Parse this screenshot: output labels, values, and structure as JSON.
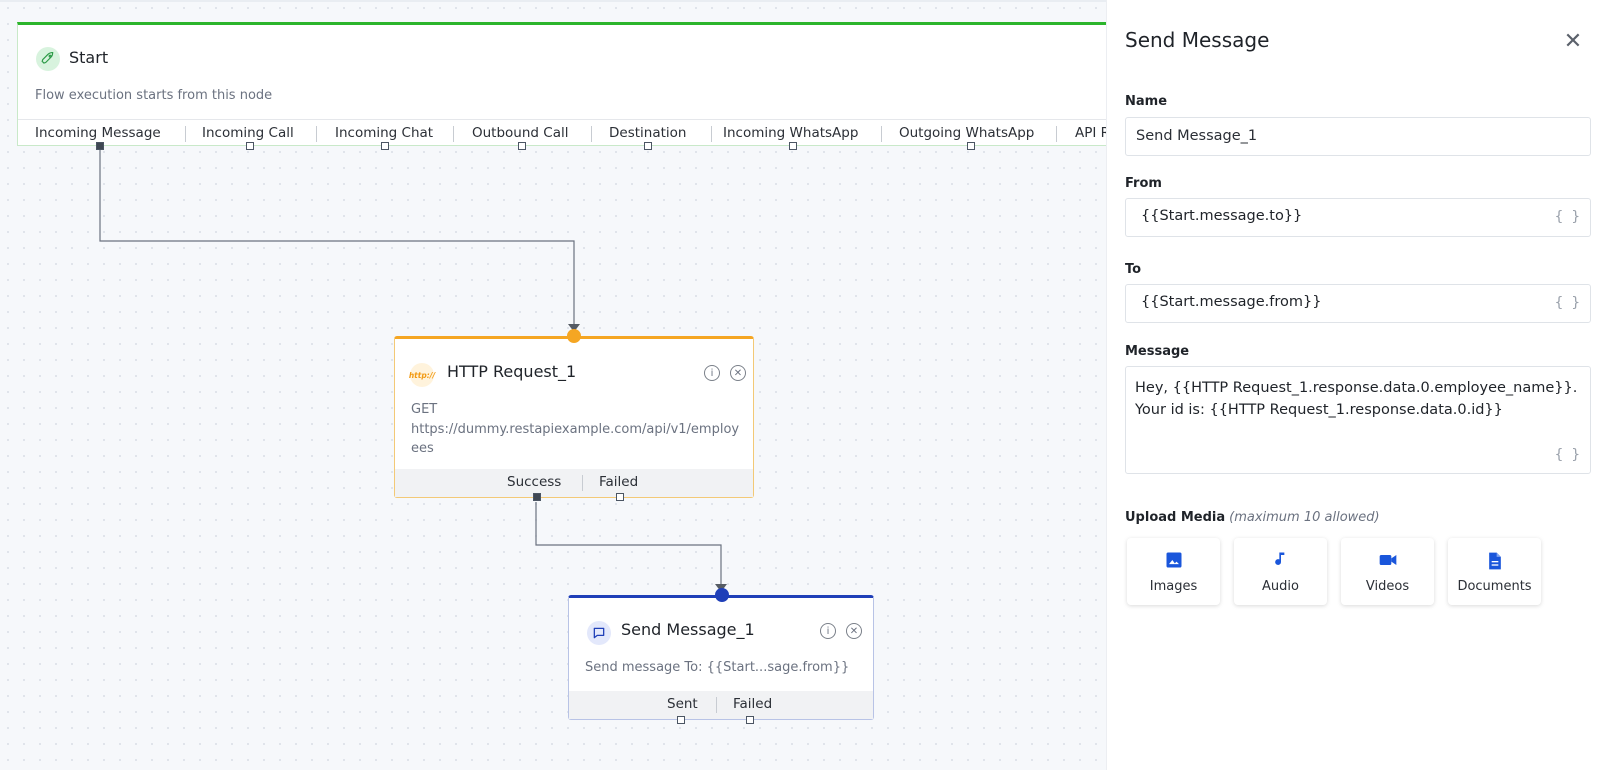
{
  "colors": {
    "start_accent": "#2cb52c",
    "http_accent": "#f5a623",
    "send_accent": "#1f3fb8",
    "media_icon": "#1a56db"
  },
  "start_node": {
    "title": "Start",
    "icon": "rocket-icon",
    "description": "Flow execution starts from this node",
    "tabs": [
      "Incoming Message",
      "Incoming Call",
      "Incoming Chat",
      "Outbound Call",
      "Destination",
      "Incoming WhatsApp",
      "Outgoing WhatsApp",
      "API R"
    ]
  },
  "http_node": {
    "title": "HTTP Request_1",
    "icon_text": "http://",
    "method": "GET",
    "url": "https://dummy.restapiexample.com/api/v1/employees",
    "outputs": [
      "Success",
      "Failed"
    ]
  },
  "send_node": {
    "title": "Send Message_1",
    "icon": "chat-icon",
    "body": "Send message To: {{Start...sage.from}}",
    "outputs": [
      "Sent",
      "Failed"
    ]
  },
  "panel": {
    "title": "Send Message",
    "name_label": "Name",
    "name_value": "Send Message_1",
    "from_label": "From",
    "from_value": "{{Start.message.to}}",
    "to_label": "To",
    "to_value": "{{Start.message.from}}",
    "message_label": "Message",
    "message_line1": "Hey, {{HTTP Request_1.response.data.0.employee_name}}.",
    "message_line2": "Your id is: {{HTTP Request_1.response.data.0.id}}",
    "brace_symbol": "{ }",
    "upload_label": "Upload Media",
    "upload_hint": "(maximum 10 allowed)",
    "media": [
      {
        "label": "Images",
        "icon": "image-icon"
      },
      {
        "label": "Audio",
        "icon": "music-note-icon"
      },
      {
        "label": "Videos",
        "icon": "video-camera-icon"
      },
      {
        "label": "Documents",
        "icon": "document-icon"
      }
    ]
  }
}
